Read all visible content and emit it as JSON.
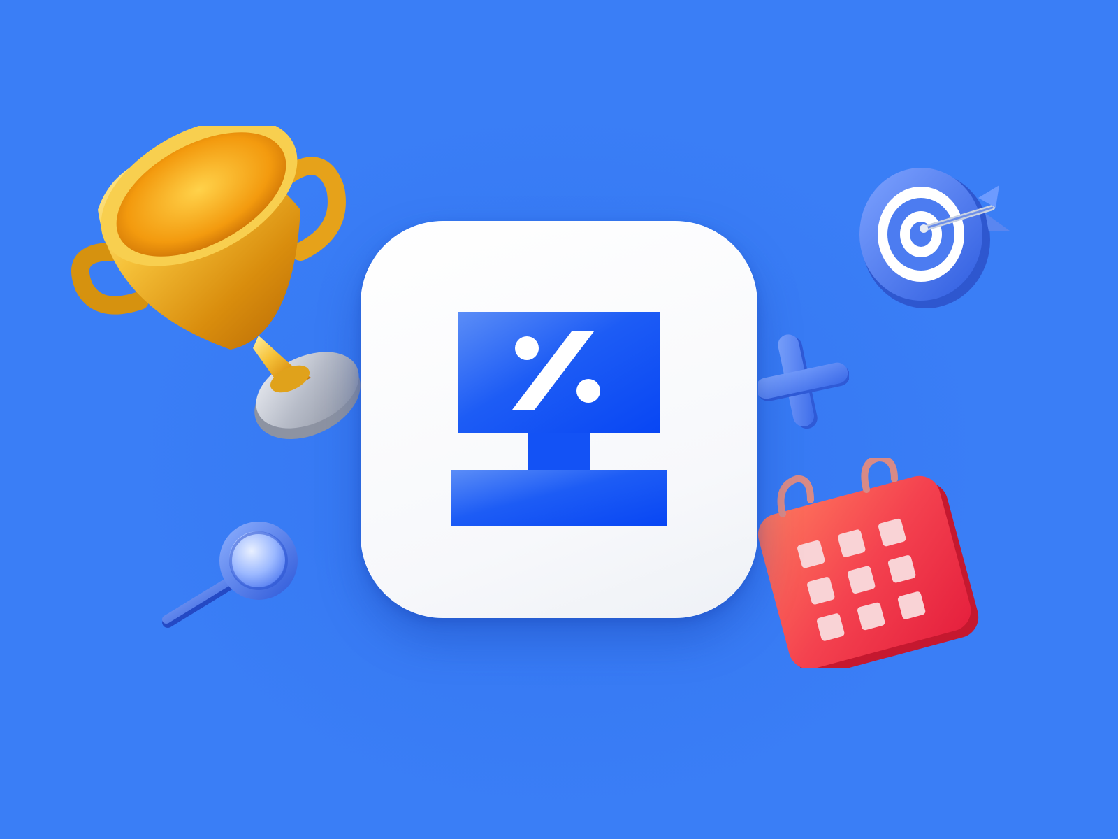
{
  "canvas": {
    "background_color": "#3a7ef6"
  },
  "app_icon": {
    "card_color": "#ffffff",
    "logo_color": "#0a4ff5",
    "symbol": "%"
  },
  "decorations": [
    {
      "name": "trophy-icon",
      "colors": [
        "#f2b21c",
        "#c9cdd6"
      ]
    },
    {
      "name": "target-icon",
      "colors": [
        "#4d7ef2",
        "#ffffff"
      ]
    },
    {
      "name": "multiply-icon",
      "colors": [
        "#4f82f2"
      ]
    },
    {
      "name": "calendar-icon",
      "colors": [
        "#f2404f",
        "#f8c9cf"
      ]
    },
    {
      "name": "magnifier-icon",
      "colors": [
        "#3d6cf0"
      ]
    }
  ]
}
